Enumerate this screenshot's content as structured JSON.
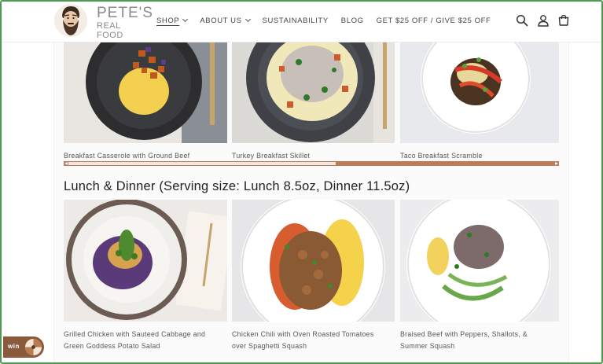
{
  "brand": {
    "line1": "PETE'S",
    "line2": "REAL FOOD",
    "logo_icon": "bearded-man-logo"
  },
  "nav": [
    {
      "label": "SHOP",
      "dropdown": true,
      "active": true
    },
    {
      "label": "ABOUT US",
      "dropdown": true,
      "active": false
    },
    {
      "label": "SUSTAINABILITY",
      "dropdown": false,
      "active": false
    },
    {
      "label": "BLOG",
      "dropdown": false,
      "active": false
    },
    {
      "label": "GET $25 OFF / GIVE $25 OFF",
      "dropdown": false,
      "active": false
    }
  ],
  "header_icons": [
    "search-icon",
    "account-icon",
    "cart-icon"
  ],
  "breakfast": {
    "items": [
      {
        "caption": "Breakfast Casserole with Ground Beef"
      },
      {
        "caption": "Turkey Breakfast Skillet"
      },
      {
        "caption": "Taco Breakfast Scramble"
      }
    ],
    "scroll_progress": 0.54
  },
  "lunch_dinner": {
    "title": "Lunch & Dinner (Serving size: Lunch 8.5oz, Dinner 11.5oz)",
    "items": [
      {
        "caption_line1": "Grilled Chicken with Sauteed Cabbage and",
        "caption_line2": "Green Goddess Potato Salad"
      },
      {
        "caption_line1": "Chicken Chili with Oven Roasted Tomatoes",
        "caption_line2": "over Spaghetti Squash"
      },
      {
        "caption_line1": "Braised Beef with Peppers, Shallots, &",
        "caption_line2": "Summer Squash"
      }
    ]
  },
  "widget": {
    "label": "win",
    "icon": "prize-wheel-icon"
  },
  "colors": {
    "accent": "#c2795a",
    "frame": "#4f9a52",
    "widget": "#8a5a3c"
  }
}
